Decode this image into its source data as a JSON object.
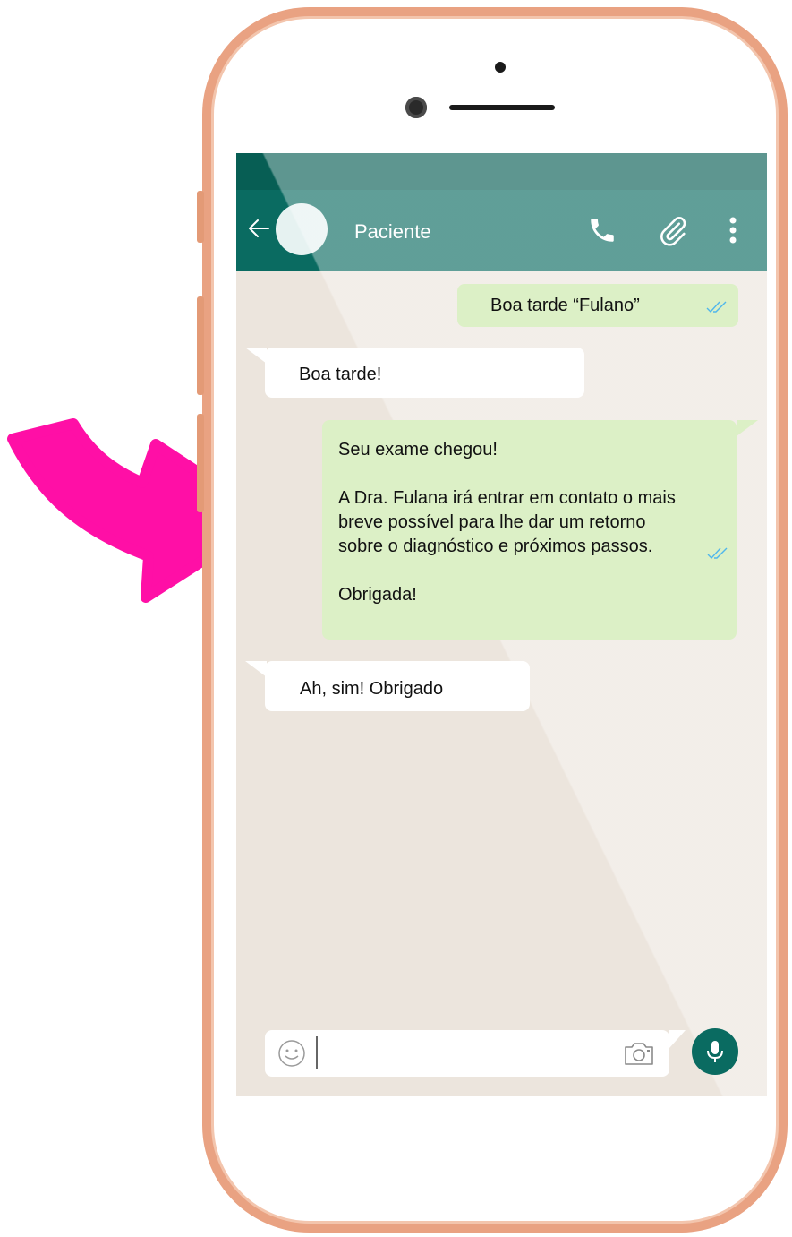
{
  "header": {
    "contact_name": "Paciente",
    "icons": [
      "back-arrow-icon",
      "phone-icon",
      "paperclip-icon",
      "more-vert-icon"
    ]
  },
  "messages": [
    {
      "direction": "outgoing",
      "lines": [
        "Boa tarde “Fulano”"
      ],
      "status": "read"
    },
    {
      "direction": "incoming",
      "lines": [
        "Boa tarde!"
      ]
    },
    {
      "direction": "outgoing",
      "lines": [
        "Seu exame chegou!",
        "",
        "A Dra. Fulana irá entrar em contato o mais",
        "breve possível para lhe dar um retorno",
        "sobre o diagnóstico e próximos passos.",
        "",
        "Obrigada!"
      ],
      "status": "read"
    },
    {
      "direction": "incoming",
      "lines": [
        "Ah, sim! Obrigado"
      ]
    }
  ],
  "composer": {
    "value": "",
    "icons": [
      "emoji-icon",
      "camera-icon",
      "microphone-icon"
    ]
  },
  "colors": {
    "phone_frame": "#e9a282",
    "header": "#0a6b61",
    "status_bar": "#075e54",
    "chat_background": "#ece5dd",
    "outgoing_bubble": "#dcf0c6",
    "incoming_bubble": "#ffffff",
    "read_ticks": "#4fb6ec",
    "annotation_arrow": "#ff0fa6"
  }
}
